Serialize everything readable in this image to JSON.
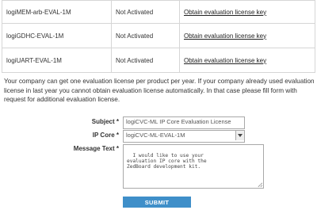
{
  "licenses": [
    {
      "name": "logiMEM-arb-EVAL-1M",
      "status": "Not Activated",
      "action": "Obtain evaluation license key"
    },
    {
      "name": "logiGDHC-EVAL-1M",
      "status": "Not Activated",
      "action": "Obtain evaluation license key"
    },
    {
      "name": "logiUART-EVAL-1M",
      "status": "Not Activated",
      "action": "Obtain evaluation license key"
    }
  ],
  "notice": "Your company can get one evaluation license per product per year. If your company already used evaluation license in last year you cannot obtain evaluation license automatically. In that case please fill form with request for additional evaluation license.",
  "form": {
    "subject_label": "Subject *",
    "subject_value": "logiCVC-ML IP Core Evaluation License",
    "ipcore_label": "IP Core *",
    "ipcore_value": "logiCVC-ML-EVAL-1M",
    "message_label": "Message Text *",
    "message_value": "I would like to use your\nevaluation IP core with the\nZedBoard development kit.",
    "submit_label": "SUBMIT"
  }
}
